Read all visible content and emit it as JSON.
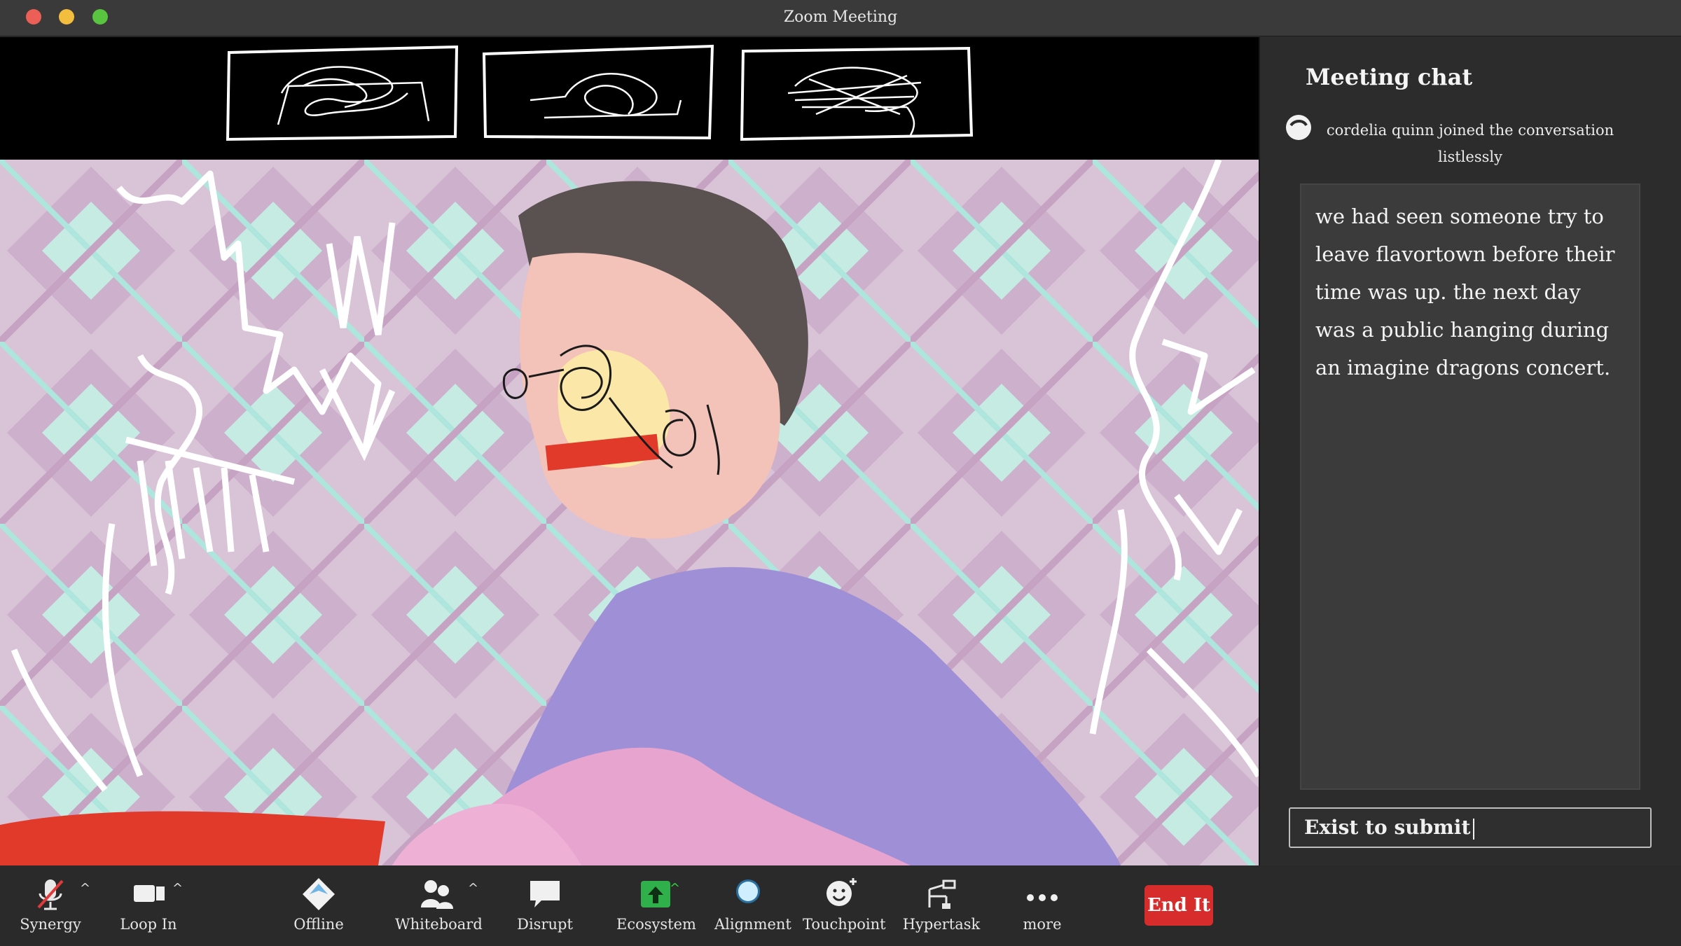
{
  "window": {
    "title": "Zoom Meeting"
  },
  "chat": {
    "title": "Meeting chat",
    "join_notice": "cordelia quinn  joined the conversation listlessly",
    "message": "we had seen someone try to leave flavortown before their time was up. the next day was a public hanging during an imagine dragons concert.",
    "input_placeholder": "Exist to submit"
  },
  "toolbar": {
    "items": [
      {
        "label": "Synergy",
        "icon": "microphone-muted-icon"
      },
      {
        "label": "Loop In",
        "icon": "video-camera-icon"
      },
      {
        "label": "Offline",
        "icon": "diamond-share-icon"
      },
      {
        "label": "Whiteboard",
        "icon": "participants-icon"
      },
      {
        "label": "Disrupt",
        "icon": "speech-bubble-icon"
      },
      {
        "label": "Ecosystem",
        "icon": "upload-arrow-icon"
      },
      {
        "label": "Alignment",
        "icon": "circle-icon"
      },
      {
        "label": "Touchpoint",
        "icon": "smiley-plus-icon"
      },
      {
        "label": "Hypertask",
        "icon": "flow-diagram-icon"
      },
      {
        "label": "more",
        "icon": "more-dots-icon"
      }
    ],
    "end_label": "End It"
  },
  "colors": {
    "end_button": "#d62c2c",
    "ecosystem_icon": "#2fb04a",
    "alignment_icon": "#6fd0ff"
  }
}
